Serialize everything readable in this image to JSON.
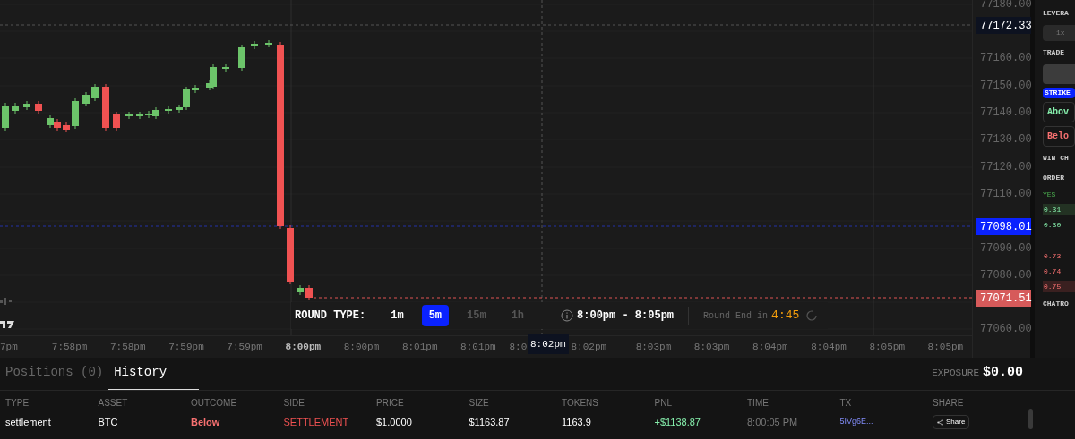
{
  "chart": {
    "price_ticks": [
      "77180.00",
      "77160.00",
      "77150.00",
      "77140.00",
      "77130.00",
      "77120.00",
      "77110.00",
      "77090.00",
      "77080.00",
      "77060.00"
    ],
    "price_tags": [
      {
        "kind": "hover",
        "text": "77172.33"
      },
      {
        "kind": "strike",
        "text": "77098.01"
      },
      {
        "kind": "last",
        "text": "77071.51"
      }
    ],
    "time_ticks": [
      {
        "text": "7pm",
        "bold": false
      },
      {
        "text": "7:58pm",
        "bold": false
      },
      {
        "text": "7:58pm",
        "bold": false
      },
      {
        "text": "7:59pm",
        "bold": false
      },
      {
        "text": "7:59pm",
        "bold": false
      },
      {
        "text": "8:00pm",
        "bold": true
      },
      {
        "text": "8:00pm",
        "bold": false
      },
      {
        "text": "8:01pm",
        "bold": false
      },
      {
        "text": "8:01pm",
        "bold": false
      },
      {
        "text": "8:0",
        "bold": false
      },
      {
        "text": "8:02pm",
        "bold": false
      },
      {
        "text": "8:03pm",
        "bold": false
      },
      {
        "text": "8:03pm",
        "bold": false
      },
      {
        "text": "8:04pm",
        "bold": false
      },
      {
        "text": "8:04pm",
        "bold": false
      },
      {
        "text": "8:05pm",
        "bold": false
      },
      {
        "text": "8:05pm",
        "bold": false
      }
    ],
    "crosshair_time": "8:02pm",
    "round_bar": {
      "label": "ROUND TYPE:",
      "options": [
        {
          "label": "1m",
          "selected": false,
          "disabled": false
        },
        {
          "label": "5m",
          "selected": true,
          "disabled": false
        },
        {
          "label": "15m",
          "selected": false,
          "disabled": true
        },
        {
          "label": "1h",
          "selected": false,
          "disabled": true
        }
      ],
      "range": "8:00pm - 8:05pm",
      "end_label": "Round End in",
      "countdown": "4:45"
    }
  },
  "side_panel": [
    {
      "kind": "label",
      "text": "LEVERA"
    },
    {
      "kind": "chip",
      "text": "1x"
    },
    {
      "kind": "label",
      "text": "TRADE"
    },
    {
      "kind": "blank"
    },
    {
      "kind": "badge",
      "text": "STRIKE"
    },
    {
      "kind": "up",
      "text": "Abov"
    },
    {
      "kind": "down",
      "text": "Belo"
    },
    {
      "kind": "label",
      "text": "WIN CH"
    },
    {
      "kind": "label",
      "text": "ORDER"
    },
    {
      "kind": "yes",
      "text": "YES"
    },
    {
      "kind": "bid",
      "text": "0.31",
      "highlight": true
    },
    {
      "kind": "bid",
      "text": "0.30",
      "highlight": false
    },
    {
      "kind": "gap"
    },
    {
      "kind": "ask",
      "text": "0.73",
      "highlight": false
    },
    {
      "kind": "ask",
      "text": "0.74",
      "highlight": false
    },
    {
      "kind": "ask",
      "text": "0.75",
      "highlight": true
    },
    {
      "kind": "label",
      "text": "CHATRO"
    }
  ],
  "tabs": [
    {
      "label": "Positions (0)",
      "selected": false
    },
    {
      "label": "History",
      "selected": true
    }
  ],
  "exposure": {
    "label": "EXPOSURE",
    "value": "$0.00"
  },
  "table": {
    "columns": [
      "TYPE",
      "ASSET",
      "OUTCOME",
      "SIDE",
      "PRICE",
      "SIZE",
      "TOKENS",
      "PNL",
      "TIME",
      "TX",
      "SHARE"
    ],
    "rows": [
      {
        "type": "settlement",
        "asset": "BTC",
        "outcome": "Below",
        "side": "SETTLEMENT",
        "price": "$1.0000",
        "size": "$1163.87",
        "tokens": "1163.9",
        "pnl": "+$1138.87",
        "time": "8:00:05 PM",
        "tx": "5IVg6E...",
        "share": "Share"
      }
    ]
  }
}
